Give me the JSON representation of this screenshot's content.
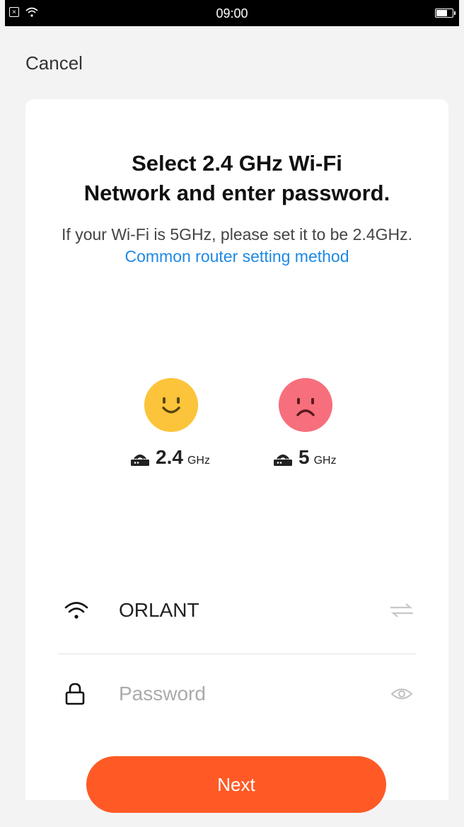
{
  "status_bar": {
    "time": "09:00",
    "sim_icon": "sim-error-icon",
    "wifi_icon": "wifi-icon",
    "battery_icon": "battery-icon"
  },
  "header": {
    "cancel_label": "Cancel"
  },
  "card": {
    "title_line1": "Select 2.4 GHz Wi-Fi",
    "title_line2": "Network and enter password.",
    "subtitle_text": "If your Wi-Fi is 5GHz, please set it to be 2.4GHz.",
    "subtitle_link": "Common router setting method",
    "bands": [
      {
        "face": "happy-face-icon",
        "router_icon": "router-icon",
        "number": "2.4",
        "unit": "GHz",
        "color": "#fcc43a"
      },
      {
        "face": "sad-face-icon",
        "router_icon": "router-icon",
        "number": "5",
        "unit": "GHz",
        "color": "#f76f7c"
      }
    ],
    "ssid": {
      "icon": "wifi-icon",
      "value": "ORLANT",
      "switch_icon": "switch-network-icon"
    },
    "password": {
      "icon": "lock-icon",
      "placeholder": "Password",
      "value": "",
      "toggle_icon": "eye-icon"
    },
    "next_label": "Next"
  },
  "colors": {
    "accent": "#ff5a26",
    "link": "#1e88e5"
  }
}
